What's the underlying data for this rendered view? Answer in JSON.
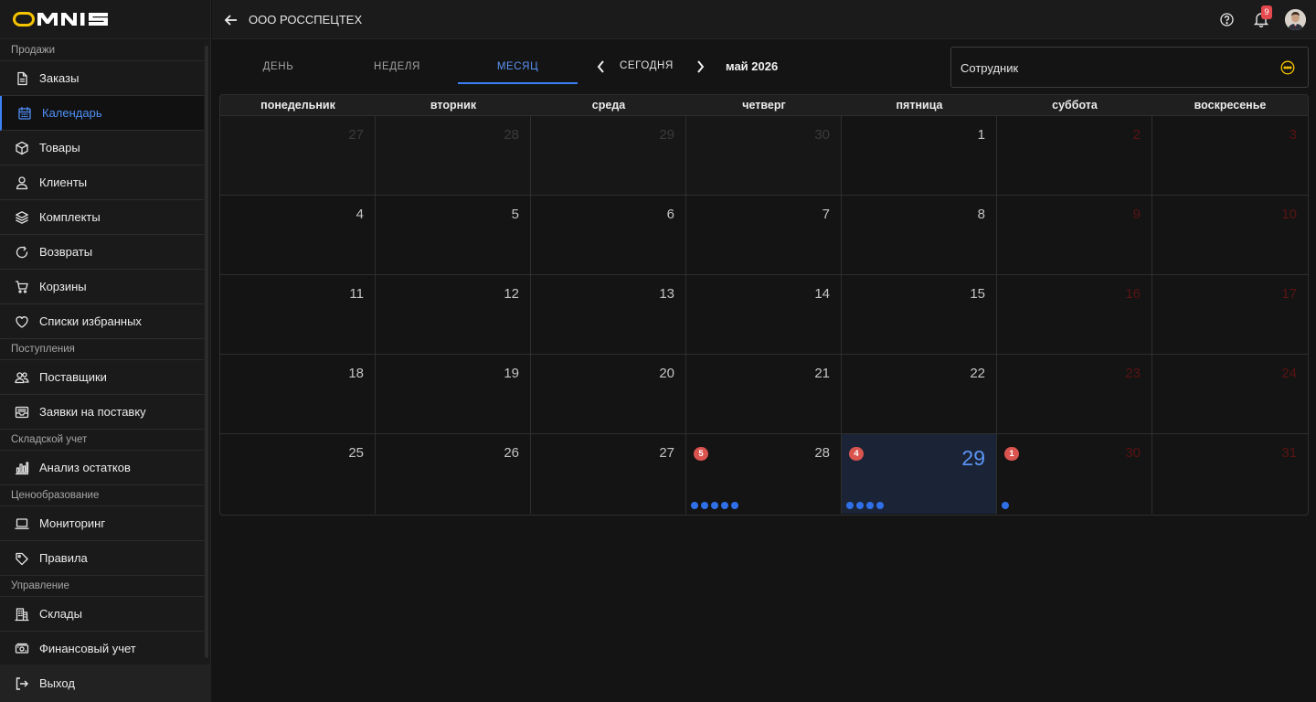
{
  "app": {
    "logo": "OMNIS"
  },
  "sidebar": {
    "sections": [
      {
        "title": "Продажи",
        "items": [
          {
            "label": "Заказы",
            "icon": "file-icon"
          },
          {
            "label": "Календарь",
            "icon": "calendar-icon",
            "active": true
          },
          {
            "label": "Товары",
            "icon": "box-icon"
          },
          {
            "label": "Клиенты",
            "icon": "user-icon"
          },
          {
            "label": "Комплекты",
            "icon": "layers-icon"
          },
          {
            "label": "Возвраты",
            "icon": "refresh-icon"
          },
          {
            "label": "Корзины",
            "icon": "cart-icon"
          },
          {
            "label": "Списки избранных",
            "icon": "heart-icon"
          }
        ]
      },
      {
        "title": "Поступления",
        "items": [
          {
            "label": "Поставщики",
            "icon": "users-icon"
          },
          {
            "label": "Заявки на поставку",
            "icon": "inbox-icon"
          }
        ]
      },
      {
        "title": "Складской учет",
        "items": [
          {
            "label": "Анализ остатков",
            "icon": "bar-chart-icon"
          }
        ]
      },
      {
        "title": "Ценообразование",
        "items": [
          {
            "label": "Мониторинг",
            "icon": "laptop-icon"
          },
          {
            "label": "Правила",
            "icon": "tag-icon"
          }
        ]
      },
      {
        "title": "Управление",
        "items": [
          {
            "label": "Склады",
            "icon": "building-icon"
          },
          {
            "label": "Финансовый учет",
            "icon": "money-icon"
          }
        ]
      }
    ],
    "logout_label": "Выход"
  },
  "header": {
    "org_name": "ООО РОССПЕЦТЕХ",
    "notifications_count": "9"
  },
  "toolbar": {
    "tabs": [
      {
        "label": "ДЕНЬ"
      },
      {
        "label": "НЕДЕЛЯ"
      },
      {
        "label": "МЕСЯЦ",
        "active": true
      }
    ],
    "today_label": "СЕГОДНЯ",
    "period_label": "май 2026",
    "employee_label": "Сотрудник"
  },
  "calendar": {
    "weekdays": [
      "понедельник",
      "вторник",
      "среда",
      "четверг",
      "пятница",
      "суббота",
      "воскресенье"
    ],
    "weeks": [
      [
        {
          "d": "27",
          "outside": true
        },
        {
          "d": "28",
          "outside": true
        },
        {
          "d": "29",
          "outside": true
        },
        {
          "d": "30",
          "outside": true
        },
        {
          "d": "1"
        },
        {
          "d": "2",
          "weekend": true
        },
        {
          "d": "3",
          "weekend": true
        }
      ],
      [
        {
          "d": "4"
        },
        {
          "d": "5"
        },
        {
          "d": "6"
        },
        {
          "d": "7"
        },
        {
          "d": "8"
        },
        {
          "d": "9",
          "weekend": true
        },
        {
          "d": "10",
          "weekend": true
        }
      ],
      [
        {
          "d": "11"
        },
        {
          "d": "12"
        },
        {
          "d": "13"
        },
        {
          "d": "14"
        },
        {
          "d": "15"
        },
        {
          "d": "16",
          "weekend": true
        },
        {
          "d": "17",
          "weekend": true
        }
      ],
      [
        {
          "d": "18"
        },
        {
          "d": "19"
        },
        {
          "d": "20"
        },
        {
          "d": "21"
        },
        {
          "d": "22"
        },
        {
          "d": "23",
          "weekend": true
        },
        {
          "d": "24",
          "weekend": true
        }
      ],
      [
        {
          "d": "25"
        },
        {
          "d": "26"
        },
        {
          "d": "27"
        },
        {
          "d": "28",
          "badge": "5",
          "dots": 5
        },
        {
          "d": "29",
          "badge": "4",
          "dots": 4,
          "today": true
        },
        {
          "d": "30",
          "weekend": true,
          "badge": "1",
          "dots": 1
        },
        {
          "d": "31",
          "weekend": true
        }
      ]
    ]
  },
  "colors": {
    "accent": "#3b82f6",
    "badge": "#d9534f",
    "logo": "#f5c400",
    "weekend": "#5a1313"
  }
}
